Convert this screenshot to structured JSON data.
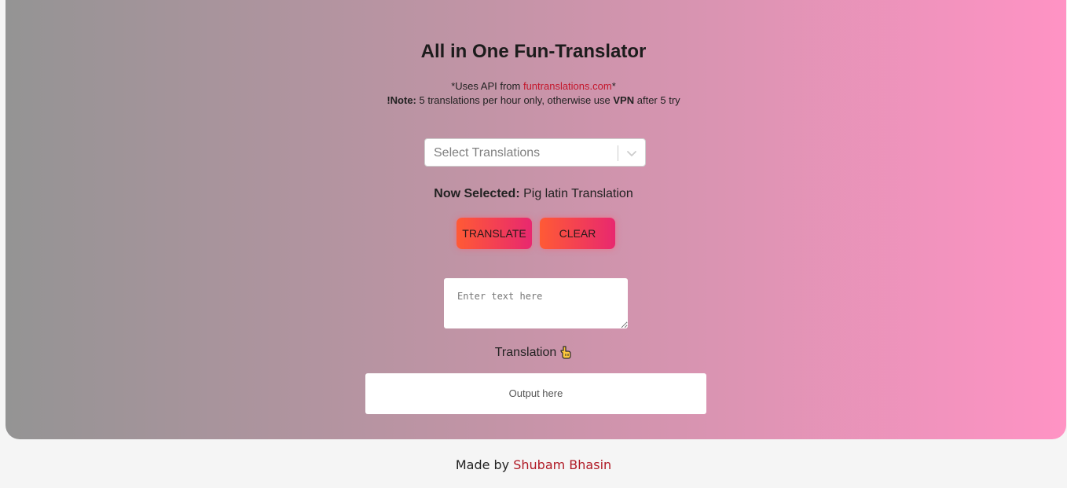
{
  "header": {
    "title": "All in One Fun-Translator",
    "api_prefix": "*Uses API from ",
    "api_link": "funtranslations.com",
    "api_suffix": "*",
    "note_label": "!Note:",
    "note_text_1": " 5 translations per hour only, otherwise use ",
    "note_vpn": "VPN",
    "note_text_2": " after 5 try"
  },
  "select": {
    "placeholder": "Select Translations",
    "icon": "chevron-down-icon"
  },
  "selected": {
    "label": "Now Selected:",
    "value": " Pig latin Translation"
  },
  "buttons": {
    "translate": "TRANSLATE",
    "clear": "CLEAR"
  },
  "input": {
    "placeholder": "Enter text here",
    "value": ""
  },
  "translation": {
    "label": "Translation",
    "icon": "pointing-down-hand-icon"
  },
  "output": {
    "text": "Output here"
  },
  "footer": {
    "prefix": "Made by ",
    "author": "Shubam Bhasin"
  },
  "colors": {
    "gradient_start": "#949494",
    "gradient_end": "#ff93c4",
    "button_start": "#ff5a35",
    "button_end": "#e8286f",
    "link": "#c4172c"
  }
}
